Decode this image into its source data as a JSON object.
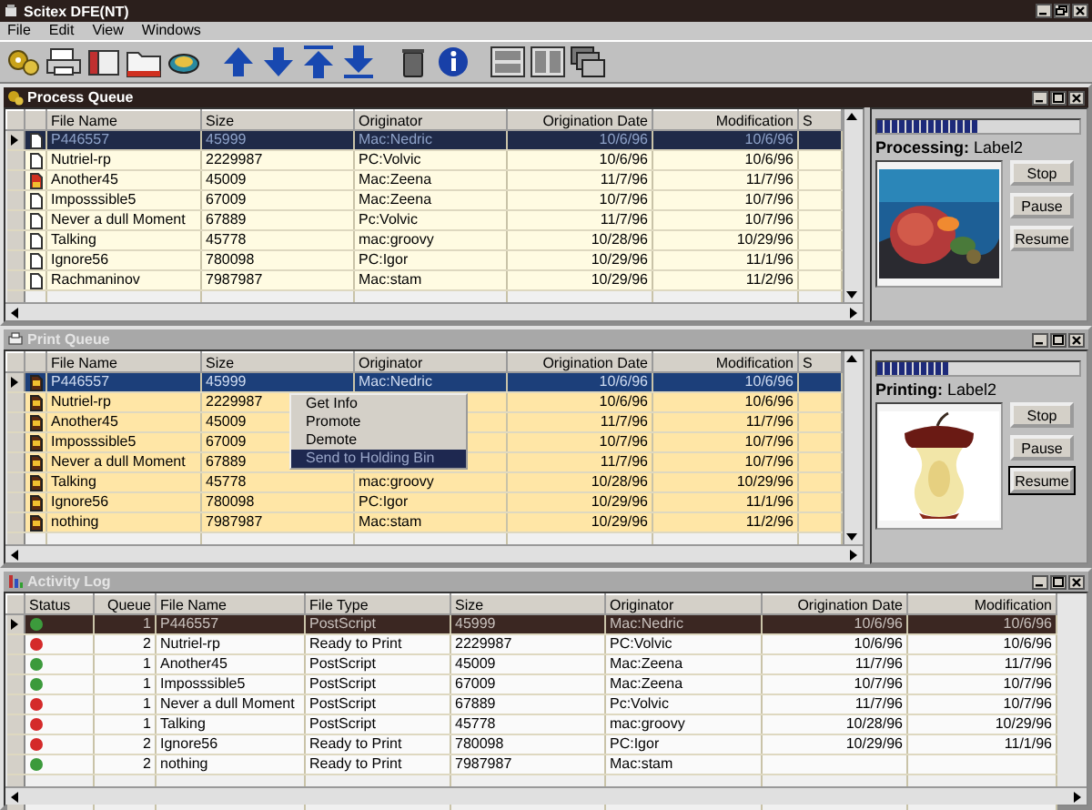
{
  "window": {
    "title": "Scitex DFE(NT)"
  },
  "menu": [
    "File",
    "Edit",
    "View",
    "Windows"
  ],
  "process_queue": {
    "title": "Process Queue",
    "active": true,
    "columns": [
      "File Name",
      "Size",
      "Originator",
      "Origination Date",
      "Modification",
      "S"
    ],
    "rows": [
      {
        "selected": true,
        "kind": "document",
        "cells": [
          "P446557",
          "45999",
          "Mac:Nedric",
          "10/6/96",
          "10/6/96"
        ]
      },
      {
        "selected": false,
        "kind": "document",
        "cells": [
          "Nutriel-rp",
          "2229987",
          "PC:Volvic",
          "10/6/96",
          "10/6/96"
        ]
      },
      {
        "selected": false,
        "kind": "active-document",
        "cells": [
          "Another45",
          "45009",
          "Mac:Zeena",
          "11/7/96",
          "11/7/96"
        ]
      },
      {
        "selected": false,
        "kind": "document",
        "cells": [
          "Imposssible5",
          "67009",
          "Mac:Zeena",
          "10/7/96",
          "10/7/96"
        ]
      },
      {
        "selected": false,
        "kind": "document",
        "cells": [
          "Never a dull Moment",
          "67889",
          "Pc:Volvic",
          "11/7/96",
          "10/7/96"
        ]
      },
      {
        "selected": false,
        "kind": "document",
        "cells": [
          "Talking",
          "45778",
          "mac:groovy",
          "10/28/96",
          "10/29/96"
        ]
      },
      {
        "selected": false,
        "kind": "document",
        "cells": [
          "Ignore56",
          "780098",
          "PC:Igor",
          "10/29/96",
          "11/1/96"
        ]
      },
      {
        "selected": false,
        "kind": "document",
        "cells": [
          "Rachmaninov",
          "7987987",
          "Mac:stam",
          "10/29/96",
          "11/2/96"
        ]
      }
    ],
    "status": {
      "label": "**Processing:** Label2",
      "level": 0.5
    },
    "buttons": [
      {
        "label": "Stop",
        "focused": false
      },
      {
        "label": "Pause",
        "focused": false
      },
      {
        "label": "Resume",
        "focused": false
      }
    ]
  },
  "print_queue": {
    "title": "Print Queue",
    "active": false,
    "columns": [
      "File Name",
      "Size",
      "Originator",
      "Origination Date",
      "Modification",
      "S"
    ],
    "rows": [
      {
        "selected": true,
        "kind": "print-job",
        "cells": [
          "P446557",
          "45999",
          "Mac:Nedric",
          "10/6/96",
          "10/6/96"
        ]
      },
      {
        "selected": false,
        "kind": "print-job",
        "cells": [
          "Nutriel-rp",
          "2229987",
          null,
          "10/6/96",
          "10/6/96"
        ]
      },
      {
        "selected": false,
        "kind": "print-job",
        "cells": [
          "Another45",
          "45009",
          null,
          "11/7/96",
          "11/7/96"
        ]
      },
      {
        "selected": false,
        "kind": "print-job",
        "cells": [
          "Imposssible5",
          "67009",
          null,
          "10/7/96",
          "10/7/96"
        ]
      },
      {
        "selected": false,
        "kind": "print-job",
        "cells": [
          "Never a dull Moment",
          "67889",
          null,
          "11/7/96",
          "10/7/96"
        ]
      },
      {
        "selected": false,
        "kind": "print-job",
        "cells": [
          "Talking",
          "45778",
          "mac:groovy",
          "10/28/96",
          "10/29/96"
        ]
      },
      {
        "selected": false,
        "kind": "print-job",
        "cells": [
          "Ignore56",
          "780098",
          "PC:Igor",
          "10/29/96",
          "11/1/96"
        ]
      },
      {
        "selected": false,
        "kind": "print-job",
        "cells": [
          "nothing",
          "7987987",
          "Mac:stam",
          "10/29/96",
          "11/2/96"
        ]
      }
    ],
    "context_menu": {
      "items": [
        {
          "label": "Get Info",
          "selected": false
        },
        {
          "label": "Promote",
          "selected": false
        },
        {
          "label": "Demote",
          "selected": false
        },
        {
          "label": "Send to Holding Bin",
          "selected": true
        }
      ]
    },
    "status": {
      "label": "**Printing:** Label2",
      "level": 0.35
    },
    "buttons": [
      {
        "label": "Stop",
        "focused": false
      },
      {
        "label": "Pause",
        "focused": false
      },
      {
        "label": "Resume",
        "focused": true
      }
    ]
  },
  "activity_log": {
    "title": "Activity Log",
    "active": false,
    "columns": [
      "Status",
      "Queue",
      "File Name",
      "File Type",
      "Size",
      "Originator",
      "Origination Date",
      "Modification"
    ],
    "rows": [
      {
        "selected": true,
        "color": "#3c9a3c",
        "cells": [
          "",
          "1",
          "P446557",
          "PostScript",
          "45999",
          "Mac:Nedric",
          "10/6/96",
          "10/6/96"
        ]
      },
      {
        "selected": false,
        "color": "#d42a2a",
        "cells": [
          "",
          "2",
          "Nutriel-rp",
          "Ready to Print",
          "2229987",
          "PC:Volvic",
          "10/6/96",
          "10/6/96"
        ]
      },
      {
        "selected": false,
        "color": "#3c9a3c",
        "cells": [
          "",
          "1",
          "Another45",
          "PostScript",
          "45009",
          "Mac:Zeena",
          "11/7/96",
          "11/7/96"
        ]
      },
      {
        "selected": false,
        "color": "#3c9a3c",
        "cells": [
          "",
          "1",
          "Imposssible5",
          "PostScript",
          "67009",
          "Mac:Zeena",
          "10/7/96",
          "10/7/96"
        ]
      },
      {
        "selected": false,
        "color": "#d42a2a",
        "cells": [
          "",
          "1",
          "Never a dull Moment",
          "PostScript",
          "67889",
          "Pc:Volvic",
          "11/7/96",
          "10/7/96"
        ]
      },
      {
        "selected": false,
        "color": "#d42a2a",
        "cells": [
          "",
          "1",
          "Talking",
          "PostScript",
          "45778",
          "mac:groovy",
          "10/28/96",
          "10/29/96"
        ]
      },
      {
        "selected": false,
        "color": "#d42a2a",
        "cells": [
          "",
          "2",
          "Ignore56",
          "Ready to Print",
          "780098",
          "PC:Igor",
          "10/29/96",
          "11/1/96"
        ]
      },
      {
        "selected": false,
        "color": "#3c9a3c",
        "cells": [
          "",
          "2",
          "nothing",
          "Ready to Print",
          "7987987",
          "Mac:stam",
          null,
          null
        ]
      }
    ]
  }
}
